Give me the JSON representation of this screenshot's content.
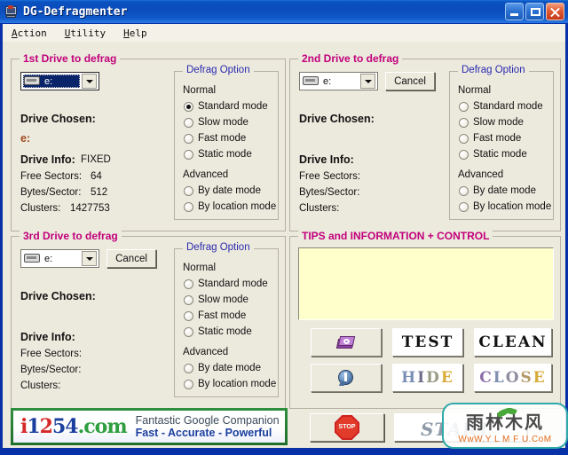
{
  "window": {
    "title": "DG-Defragmenter",
    "icon": "defrag-monitor-icon",
    "minimize_label": "Minimize",
    "maximize_label": "Maximize",
    "close_label": "Close"
  },
  "menu": [
    {
      "label": "Action",
      "accel": "A"
    },
    {
      "label": "Utility",
      "accel": "U"
    },
    {
      "label": "Help",
      "accel": "H"
    }
  ],
  "colors": {
    "title_bar": "#0b4cbb",
    "client_bg": "#ece9dd",
    "group_title_pink": "#c2007b",
    "group_title_blue": "#2a2ab0",
    "tips_bg": "#ffffcc",
    "drive_value": "#a24b1e"
  },
  "drive_panels": [
    {
      "title": "1st Drive to defrag",
      "combo_value": "e:",
      "combo_focused": true,
      "has_cancel": false,
      "cancel_label": "",
      "chosen_label": "Drive Chosen:",
      "chosen_value": "e:",
      "info_label": "Drive Info:",
      "info_value": "FIXED",
      "free_sectors_label": "Free Sectors:",
      "free_sectors_value": "64",
      "bytes_sector_label": "Bytes/Sector:",
      "bytes_sector_value": "512",
      "clusters_label": "Clusters:",
      "clusters_value": "1427753",
      "options": {
        "title": "Defrag Option",
        "normal_label": "Normal",
        "advanced_label": "Advanced",
        "selected": "Standard mode",
        "normal_modes": [
          "Standard mode",
          "Slow mode",
          "Fast mode",
          "Static mode"
        ],
        "advanced_modes": [
          "By date mode",
          "By location mode"
        ]
      }
    },
    {
      "title": "2nd Drive to defrag",
      "combo_value": "e:",
      "combo_focused": false,
      "has_cancel": true,
      "cancel_label": "Cancel",
      "chosen_label": "Drive Chosen:",
      "chosen_value": "",
      "info_label": "Drive Info:",
      "info_value": "",
      "free_sectors_label": "Free Sectors:",
      "free_sectors_value": "",
      "bytes_sector_label": "Bytes/Sector:",
      "bytes_sector_value": "",
      "clusters_label": "Clusters:",
      "clusters_value": "",
      "options": {
        "title": "Defrag Option",
        "normal_label": "Normal",
        "advanced_label": "Advanced",
        "selected": "",
        "normal_modes": [
          "Standard mode",
          "Slow mode",
          "Fast mode",
          "Static mode"
        ],
        "advanced_modes": [
          "By date mode",
          "By location mode"
        ]
      }
    },
    {
      "title": "3rd Drive to defrag",
      "combo_value": "e:",
      "combo_focused": false,
      "has_cancel": true,
      "cancel_label": "Cancel",
      "chosen_label": "Drive Chosen:",
      "chosen_value": "",
      "info_label": "Drive Info:",
      "info_value": "",
      "free_sectors_label": "Free Sectors:",
      "free_sectors_value": "",
      "bytes_sector_label": "Bytes/Sector:",
      "bytes_sector_value": "",
      "clusters_label": "Clusters:",
      "clusters_value": "",
      "options": {
        "title": "Defrag Option",
        "normal_label": "Normal",
        "advanced_label": "Advanced",
        "selected": "",
        "normal_modes": [
          "Standard mode",
          "Slow mode",
          "Fast mode",
          "Static mode"
        ],
        "advanced_modes": [
          "By date mode",
          "By location mode"
        ]
      }
    }
  ],
  "tips": {
    "title": "TIPS and INFORMATION + CONTROL",
    "content": ""
  },
  "actions": {
    "help_book_icon": "book-icon",
    "info_icon": "info-icon",
    "test_label": "TEST",
    "clean_label": "CLEAN",
    "hide_label": "HIDE",
    "close_label": "CLOSE",
    "stop_icon": "stop-sign-icon",
    "stop_text": "STOP",
    "start_label": "START"
  },
  "banner": {
    "logo_i": "i",
    "logo_1": "1",
    "logo_2": "2",
    "logo_5": "5",
    "logo_4": "4",
    "logo_dot": ".",
    "logo_com": "com",
    "line1": "Fantastic Google Companion",
    "line2": "Fast - Accurate - Powerful"
  },
  "watermark": {
    "text_cn": "雨林木风",
    "url": "WwW.Y L M F U.CoM"
  }
}
